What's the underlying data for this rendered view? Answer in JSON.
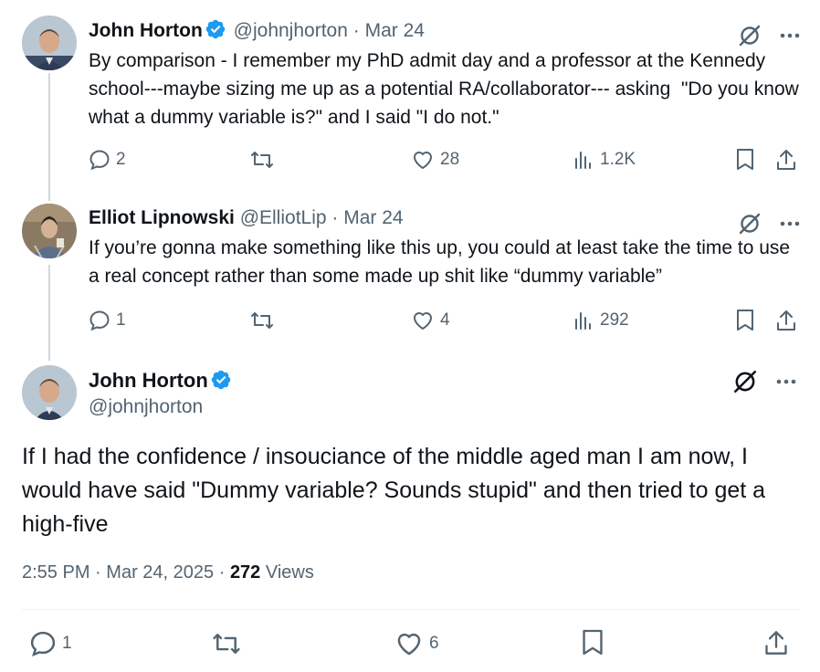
{
  "tweets": [
    {
      "name": "John Horton",
      "handle": "@johnjhorton",
      "separator": "·",
      "date": "Mar 24",
      "text": "By comparison - I remember my PhD admit day and a professor at the Kennedy school---maybe sizing me up as a potential RA/collaborator--- asking  \"Do you know what a dummy variable is?\" and I said \"I do not.\"",
      "replies": "2",
      "retweets": "",
      "likes": "28",
      "views": "1.2K",
      "verified": true
    },
    {
      "name": "Elliot Lipnowski",
      "handle": "@ElliotLip",
      "separator": "·",
      "date": "Mar 24",
      "text": "If you’re gonna make something like this up, you could at least take the time to use a real concept rather than some made up shit like “dummy variable”",
      "replies": "1",
      "retweets": "",
      "likes": "4",
      "views": "292",
      "verified": false
    }
  ],
  "main": {
    "name": "John Horton",
    "handle": "@johnjhorton",
    "text": "If I had the confidence / insouciance of the middle aged man I am now, I would have said \"Dummy variable? Sounds stupid\" and then tried to get a high-five",
    "time": "2:55 PM",
    "sep1": "·",
    "date": "Mar 24, 2025",
    "sep2": "·",
    "views_count": "272",
    "views_label": "Views",
    "replies": "1",
    "likes": "6"
  },
  "colors": {
    "text": "#0f1419",
    "secondary": "#536471",
    "verified": "#1d9bf0",
    "thread_line": "#cfd9de"
  }
}
